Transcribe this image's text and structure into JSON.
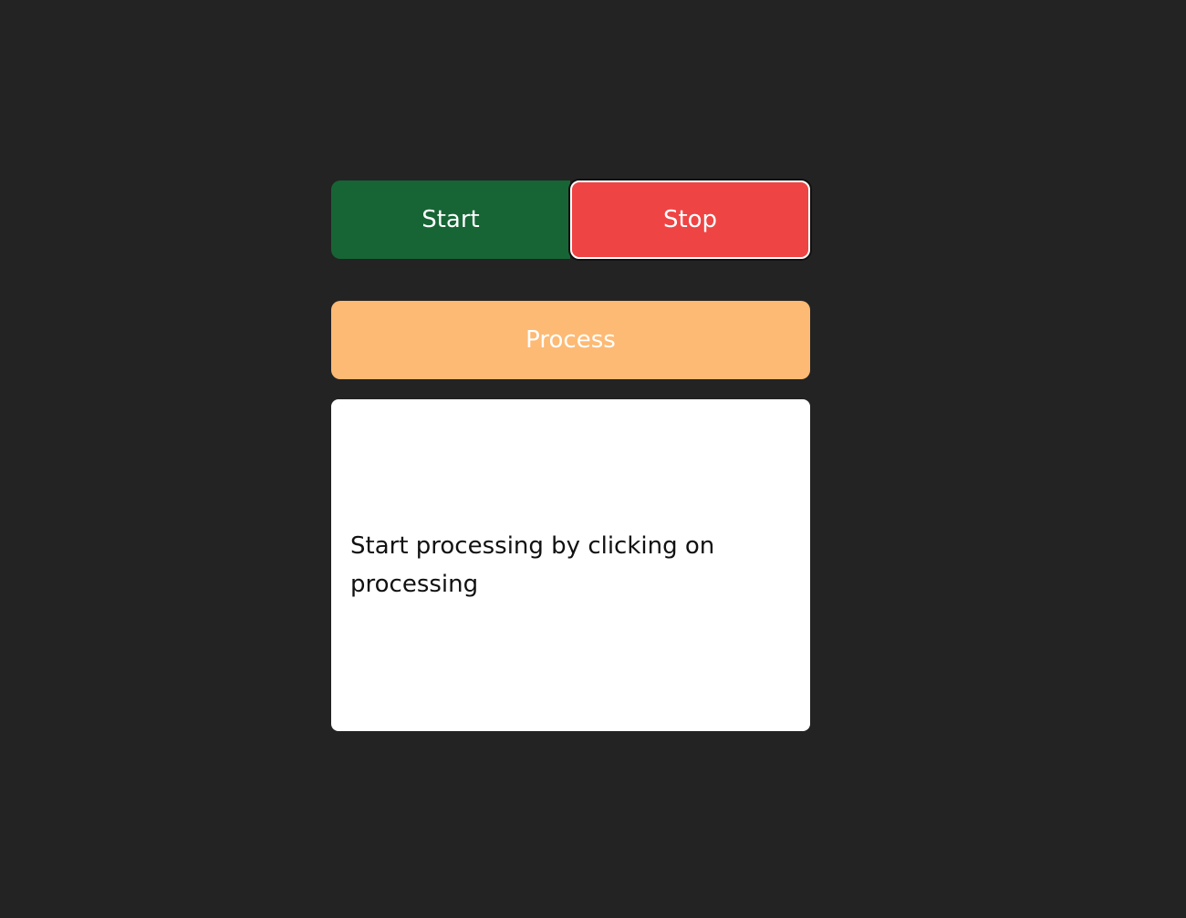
{
  "controls": {
    "start_label": "Start",
    "stop_label": "Stop",
    "process_label": "Process"
  },
  "output": {
    "message": "Start processing by clicking on processing"
  },
  "colors": {
    "background": "#232323",
    "start": "#176535",
    "stop": "#ef4444",
    "process": "#fdba74",
    "output_bg": "#ffffff"
  }
}
